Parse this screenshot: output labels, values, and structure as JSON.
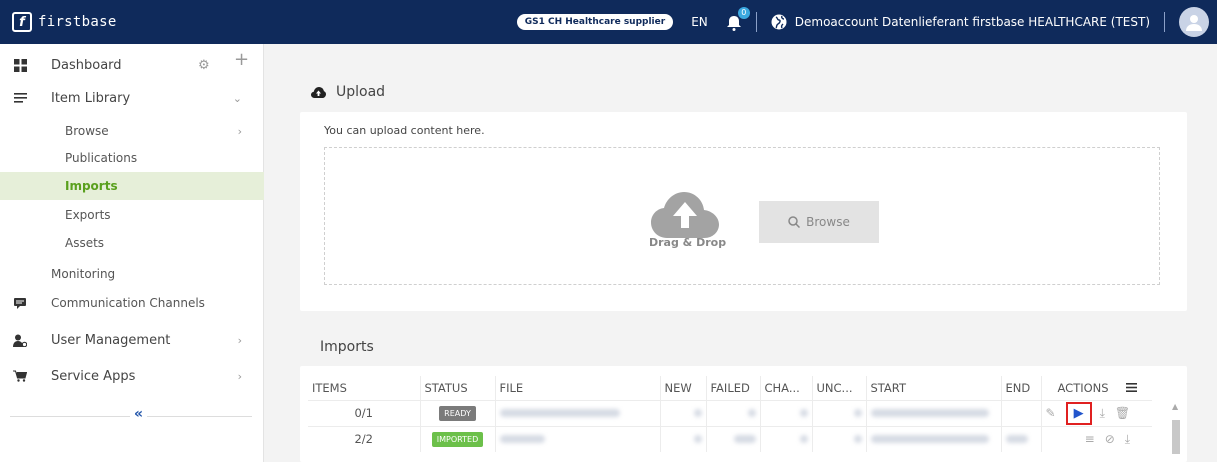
{
  "topbar": {
    "brand": "firstbase",
    "brand_logo": "f",
    "supplier_badge": "GS1 CH Healthcare supplier",
    "language": "EN",
    "notifications_count": "0",
    "account": "Demoaccount Datenlieferant firstbase HEALTHCARE (TEST)"
  },
  "sidebar": {
    "dashboard": "Dashboard",
    "item_library": "Item Library",
    "browse": "Browse",
    "publications": "Publications",
    "imports": "Imports",
    "exports": "Exports",
    "assets": "Assets",
    "monitoring": "Monitoring",
    "communication_channels": "Communication Channels",
    "user_management": "User Management",
    "service_apps": "Service Apps",
    "collapse": "«"
  },
  "upload": {
    "title": "Upload",
    "hint": "You can upload content here.",
    "drag_drop": "Drag & Drop",
    "browse": "Browse"
  },
  "imports": {
    "title": "Imports",
    "columns": [
      "ITEMS",
      "STATUS",
      "FILE",
      "NEW",
      "FAILED",
      "CHA...",
      "UNC...",
      "START",
      "END",
      "ACTIONS"
    ],
    "rows": [
      {
        "items": "0/1",
        "status": "READY"
      },
      {
        "items": "2/2",
        "status": "IMPORTED"
      }
    ]
  },
  "colors": {
    "topbar": "#0f2a5b",
    "active_bg": "#e6efd9",
    "active_text": "#5aa01e",
    "ready_badge": "#7b7b7b",
    "imported_badge": "#6cc04a",
    "highlight": "#e02020"
  }
}
